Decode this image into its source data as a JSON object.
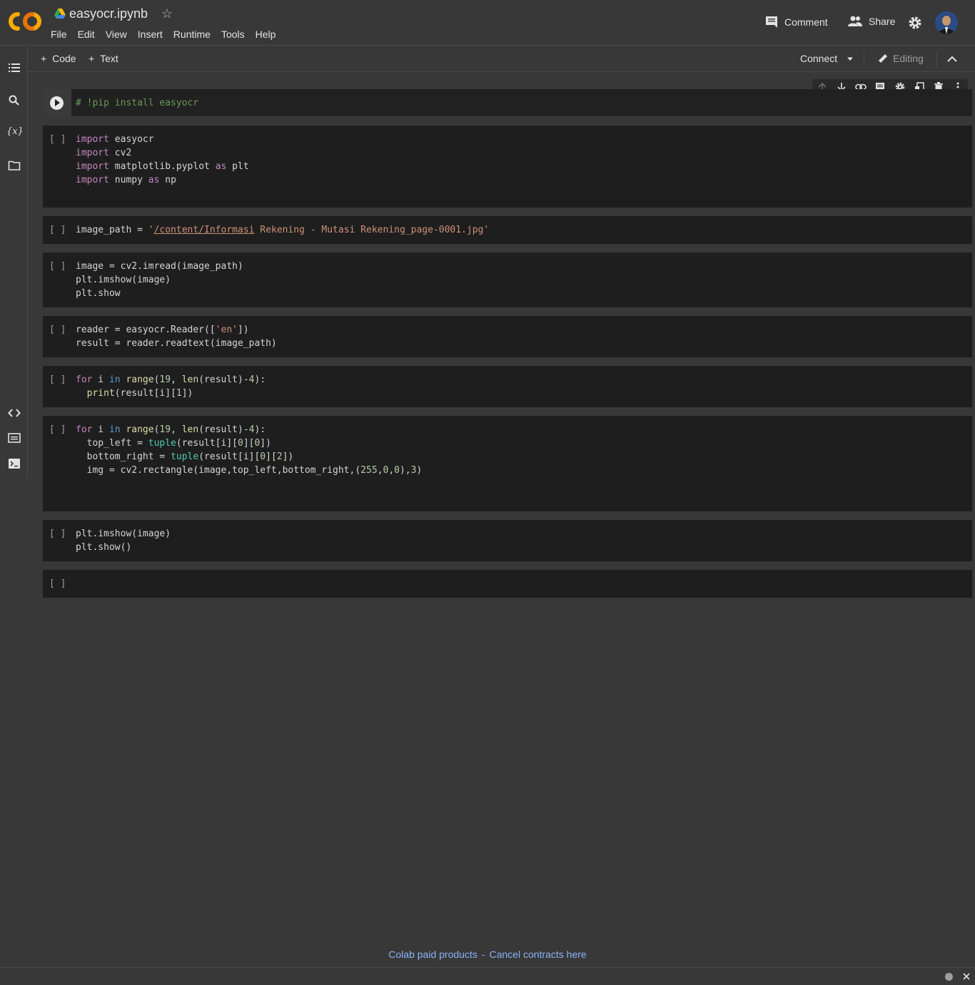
{
  "header": {
    "title": "easyocr.ipynb",
    "menu": [
      "File",
      "Edit",
      "View",
      "Insert",
      "Runtime",
      "Tools",
      "Help"
    ],
    "comment_label": "Comment",
    "share_label": "Share"
  },
  "toolbar": {
    "code_label": "Code",
    "text_label": "Text",
    "connect_label": "Connect",
    "editing_label": "Editing"
  },
  "cells": [
    {
      "bracket": "",
      "lines": [
        "# !pip install easyocr"
      ]
    },
    {
      "bracket": "[ ]",
      "lines": [
        "import easyocr",
        "import cv2",
        "import matplotlib.pyplot as plt",
        "import numpy as np"
      ]
    },
    {
      "bracket": "[ ]",
      "lines": [
        "image_path = '/content/Informasi Rekening - Mutasi Rekening_page-0001.jpg'"
      ]
    },
    {
      "bracket": "[ ]",
      "lines": [
        "image = cv2.imread(image_path)",
        "plt.imshow(image)",
        "plt.show"
      ]
    },
    {
      "bracket": "[ ]",
      "lines": [
        "reader = easyocr.Reader(['en'])",
        "result = reader.readtext(image_path)"
      ]
    },
    {
      "bracket": "[ ]",
      "lines": [
        "for i in range(19, len(result)-4):",
        "  print(result[i][1])"
      ]
    },
    {
      "bracket": "[ ]",
      "lines": [
        "for i in range(19, len(result)-4):",
        "  top_left = tuple(result[i][0][0])",
        "  bottom_right = tuple(result[i][0][2])",
        "  img = cv2.rectangle(image,top_left,bottom_right,(255,0,0),3)"
      ]
    },
    {
      "bracket": "[ ]",
      "lines": [
        "plt.imshow(image)",
        "plt.show()"
      ]
    },
    {
      "bracket": "[ ]",
      "lines": []
    }
  ],
  "footer": {
    "paid_products": "Colab paid products",
    "separator": "-",
    "cancel_contracts": "Cancel contracts here"
  },
  "colors": {
    "background": "#383838",
    "cell_bg": "#1e1e1e",
    "link": "#8ab4f8",
    "logo_orange": "#f9ab00"
  }
}
